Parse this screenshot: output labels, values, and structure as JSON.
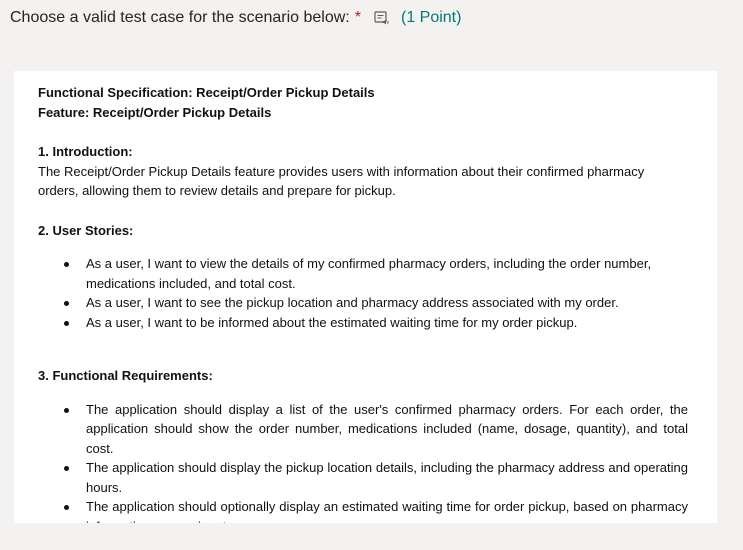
{
  "question": {
    "text": "Choose a valid test case for the scenario below:",
    "required_marker": "*",
    "points": "(1 Point)",
    "speaker_icon": "immersive-reader-icon"
  },
  "spec": {
    "title": "Functional Specification: Receipt/Order Pickup Details",
    "feature": "Feature: Receipt/Order Pickup Details",
    "sections": {
      "intro_heading": "1. Introduction:",
      "intro_text": "The Receipt/Order Pickup Details feature provides users with information about their confirmed pharmacy orders, allowing them to review details and prepare for pickup.",
      "stories_heading": "2. User Stories:",
      "stories": [
        "As a user, I want to view the details of my confirmed pharmacy orders, including the order number, medications included, and total cost.",
        "As a user, I want to see the pickup location and pharmacy address associated with my order.",
        "As a user, I want to be informed about the estimated waiting time for my order pickup."
      ],
      "req_heading": "3. Functional Requirements:",
      "requirements": [
        "The application should display a list of the user's confirmed pharmacy orders. For each order, the application should show the order number, medications included (name, dosage, quantity), and total cost.",
        "The application should display the pickup location details, including the pharmacy address and operating hours.",
        "The application should optionally display an estimated waiting time for order pickup, based on pharmacy information or user input."
      ]
    }
  }
}
